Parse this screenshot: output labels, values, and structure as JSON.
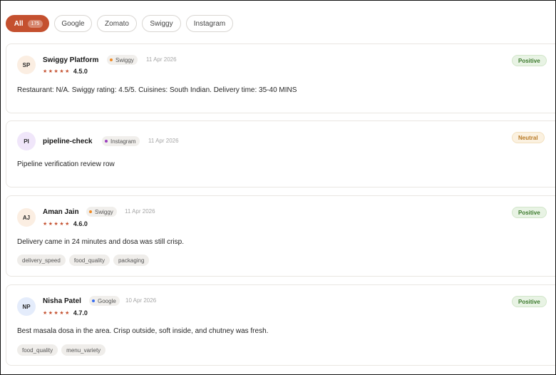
{
  "colors": {
    "accent": "#c4502f",
    "positive": "#3d7a2e",
    "neutral": "#b87a26",
    "swiggy_dot": "#f08a24",
    "instagram_dot": "#9b3fbf",
    "google_dot": "#3b6ff0"
  },
  "filters": {
    "all": {
      "label": "All",
      "count": "175"
    },
    "google": "Google",
    "zomato": "Zomato",
    "swiggy": "Swiggy",
    "instagram": "Instagram"
  },
  "reviews": [
    {
      "initials": "SP",
      "name": "Swiggy Platform",
      "source": "Swiggy",
      "date": "11 Apr 2026",
      "stars": "★★★★★",
      "rating": "4.5.0",
      "sentiment": "Positive",
      "text": "Restaurant: N/A. Swiggy rating: 4.5/5. Cuisines: South Indian. Delivery time: 35-40 MINS",
      "tags": []
    },
    {
      "initials": "PI",
      "name": "pipeline-check",
      "source": "Instagram",
      "date": "11 Apr 2026",
      "sentiment": "Neutral",
      "text": "Pipeline verification review row",
      "tags": []
    },
    {
      "initials": "AJ",
      "name": "Aman Jain",
      "source": "Swiggy",
      "date": "11 Apr 2026",
      "stars": "★★★★★",
      "rating": "4.6.0",
      "sentiment": "Positive",
      "text": "Delivery came in 24 minutes and dosa was still crisp.",
      "tags": [
        "delivery_speed",
        "food_quality",
        "packaging"
      ]
    },
    {
      "initials": "NP",
      "name": "Nisha Patel",
      "source": "Google",
      "date": "10 Apr 2026",
      "stars": "★★★★★",
      "rating": "4.7.0",
      "sentiment": "Positive",
      "text": "Best masala dosa in the area. Crisp outside, soft inside, and chutney was fresh.",
      "tags": [
        "food_quality",
        "menu_variety"
      ]
    }
  ]
}
